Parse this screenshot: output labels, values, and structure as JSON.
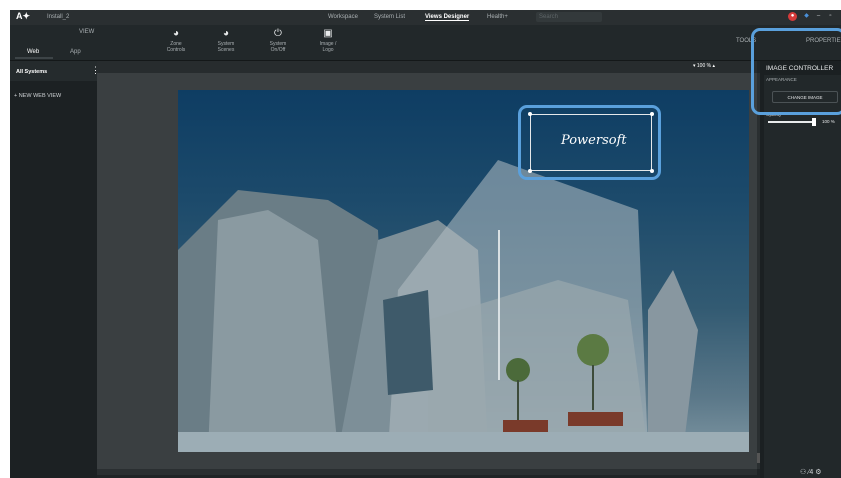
{
  "app": {
    "logo": "A✦",
    "project": "Install_2",
    "menu": [
      "Workspace",
      "System List",
      "Views Designer",
      "Health+"
    ],
    "active_menu_index": 2,
    "search_placeholder": "Search",
    "accent": "#5aa0dc"
  },
  "toolbar": {
    "view_label": "VIEW",
    "view_tabs": [
      "Web",
      "App"
    ],
    "tools": [
      {
        "label": "Zone\nControls",
        "icon": "zone-controls-icon"
      },
      {
        "label": "System\nScenes",
        "icon": "system-scenes-icon"
      },
      {
        "label": "System\nOn/Off",
        "icon": "power-icon"
      },
      {
        "label": "Image /\nLogo",
        "icon": "image-icon"
      }
    ],
    "tools_label": "TOOLS",
    "properties_label": "PROPERTIE"
  },
  "sidebar": {
    "all_systems": "All Systems",
    "new_web_view": "+ NEW WEB VIEW"
  },
  "canvas": {
    "zoom": "100 %",
    "logo_text": "Powersoft"
  },
  "image_controller": {
    "title": "IMAGE CONTROLLER",
    "appearance": "APPEARANCE",
    "change_image": "CHANGE IMAGE",
    "opacity_label": "Opacity",
    "opacity_value": "100 %",
    "opacity_fraction": 1.0
  }
}
